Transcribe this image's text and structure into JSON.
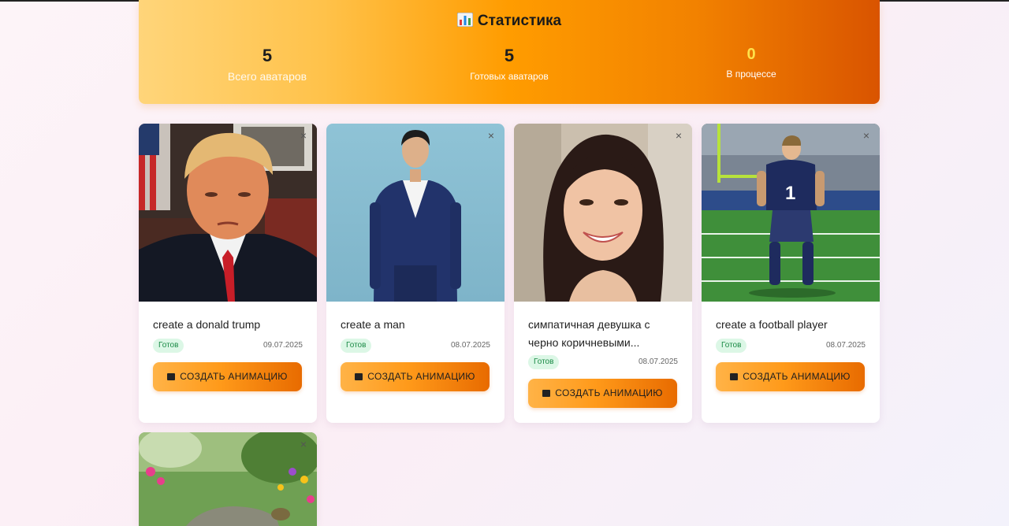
{
  "stats": {
    "title": "Статистика",
    "icon": "bar-chart-icon",
    "items": [
      {
        "value": "5",
        "label": "Всего аватаров"
      },
      {
        "value": "5",
        "label": "Готовых аватаров"
      },
      {
        "value": "0",
        "label": "В процессе"
      }
    ]
  },
  "cards": [
    {
      "title": "create a donald trump",
      "status": "Готов",
      "date": "09.07.2025",
      "button": "СОЗДАТЬ АНИМАЦИЮ",
      "close": "×"
    },
    {
      "title": "create a man",
      "status": "Готов",
      "date": "08.07.2025",
      "button": "СОЗДАТЬ АНИМАЦИЮ",
      "close": "×"
    },
    {
      "title": "симпатичная девушка с черно коричневыми...",
      "status": "Готов",
      "date": "08.07.2025",
      "button": "СОЗДАТЬ АНИМАЦИЮ",
      "close": "×"
    },
    {
      "title": "create a football player",
      "status": "Готов",
      "date": "08.07.2025",
      "button": "СОЗДАТЬ АНИМАЦИЮ",
      "close": "×"
    },
    {
      "close": "×"
    }
  ],
  "colors": {
    "accent_start": "#ffd57a",
    "accent_end": "#d95400",
    "badge_bg": "#dcf7e6",
    "badge_text": "#1a8a45"
  }
}
